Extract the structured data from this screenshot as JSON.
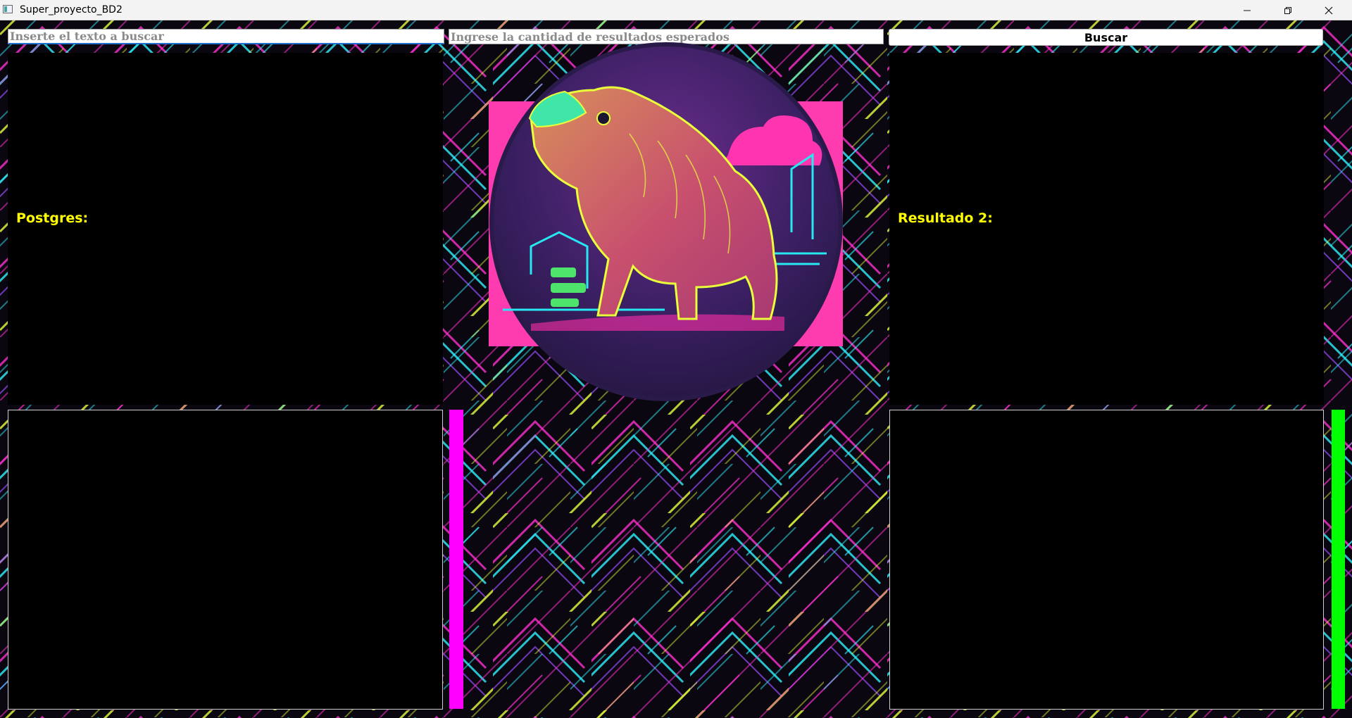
{
  "window": {
    "title": "Super_proyecto_BD2",
    "icon": "app-window-icon",
    "controls": [
      "minimize-icon",
      "restore-icon",
      "close-icon"
    ]
  },
  "search": {
    "query_placeholder": "Inserte el texto a buscar",
    "query_value": "",
    "count_placeholder": "Ingrese la cantidad de resultados esperados",
    "count_value": "",
    "button_label": "Buscar"
  },
  "results": {
    "left_label": "Postgres:",
    "right_label": "Resultado 2:"
  },
  "colors": {
    "label": "#ffff00",
    "left_bar": "#ff00ff",
    "right_bar": "#00ff00",
    "panel": "#000000",
    "background_neon": [
      "#ff2fd0",
      "#2ef2ff",
      "#e8ff3a",
      "#9a4dff"
    ]
  },
  "images": {
    "logo": "neon capybara illustration"
  }
}
